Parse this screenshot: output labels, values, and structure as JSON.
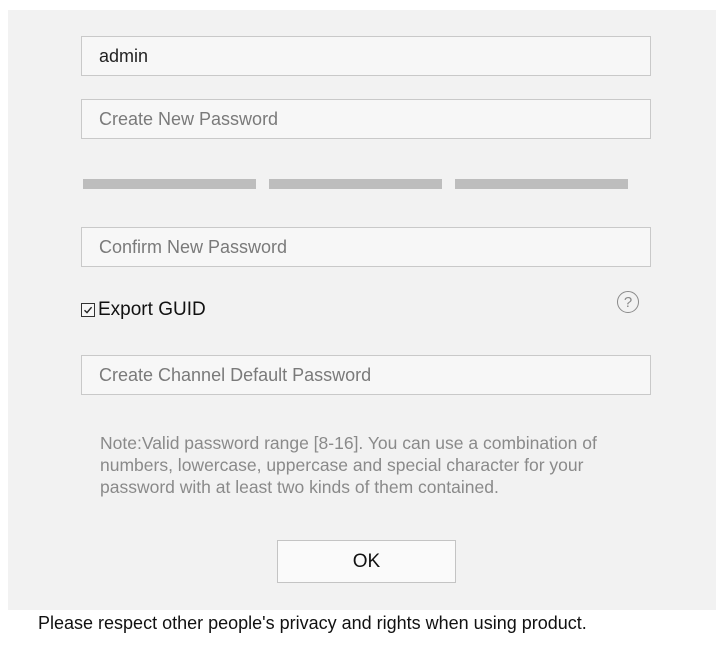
{
  "form": {
    "username_value": "admin",
    "new_password_placeholder": "Create New Password",
    "confirm_password_placeholder": "Confirm New Password",
    "export_guid_label": "Export GUID",
    "export_guid_checked": true,
    "channel_password_placeholder": "Create Channel Default Password",
    "note": "Note:Valid password range [8-16]. You can use a combination of numbers, lowercase, uppercase and special character for your password with at least two kinds of them contained.",
    "ok_label": "OK"
  },
  "icons": {
    "checkbox_mark": "☑",
    "help": "?"
  },
  "colors": {
    "panel_background": "#f2f2f2",
    "strength_bar": "#bdbdbd"
  },
  "footer": {
    "text": "Please respect other people's privacy and rights when using product."
  }
}
